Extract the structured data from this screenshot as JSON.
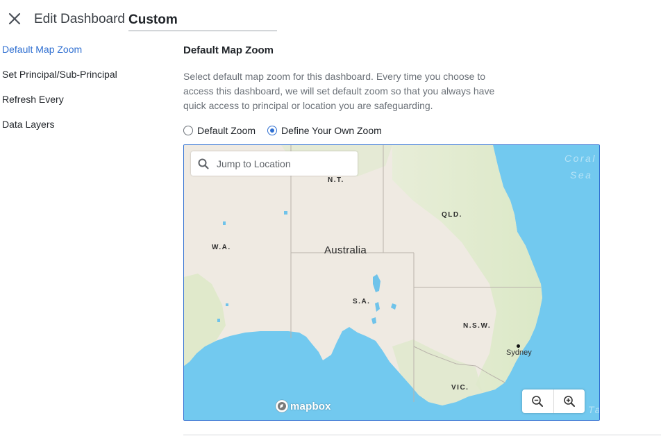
{
  "header": {
    "title": "Edit Dashboard",
    "dashboard_name": "Custom"
  },
  "sidebar": {
    "items": [
      {
        "label": "Default Map Zoom",
        "active": true
      },
      {
        "label": "Set Principal/Sub-Principal",
        "active": false
      },
      {
        "label": "Refresh Every",
        "active": false
      },
      {
        "label": "Data Layers",
        "active": false
      }
    ]
  },
  "main": {
    "section_title": "Default Map Zoom",
    "description": "Select default map zoom for this dashboard. Every time you choose to access this dashboard, we will set default zoom so that you always have quick access to principal or location you are safeguarding.",
    "zoom_options": [
      {
        "label": "Default Zoom",
        "selected": false
      },
      {
        "label": "Define Your Own Zoom",
        "selected": true
      }
    ]
  },
  "map": {
    "search_placeholder": "Jump to Location",
    "country_label": "Australia",
    "region_labels": {
      "nt": "N.T.",
      "wa": "W.A.",
      "qld": "QLD.",
      "sa": "S.A.",
      "nsw": "N.S.W.",
      "vic": "VIC."
    },
    "city_label": "Sydney",
    "sea_label_line1": "Coral",
    "sea_label_line2": "Sea",
    "sea_label_partial": "Ta",
    "attribution": "mapbox",
    "colors": {
      "water": "#72c9ef",
      "land": "#efeae2",
      "vegetation": "#dfe9c9",
      "accent": "#2f6fd1"
    }
  },
  "icons": {
    "close": "close-icon",
    "search": "search-icon",
    "zoom_out": "zoom-out-icon",
    "zoom_in": "zoom-in-icon",
    "mapbox": "mapbox-logo-icon"
  }
}
